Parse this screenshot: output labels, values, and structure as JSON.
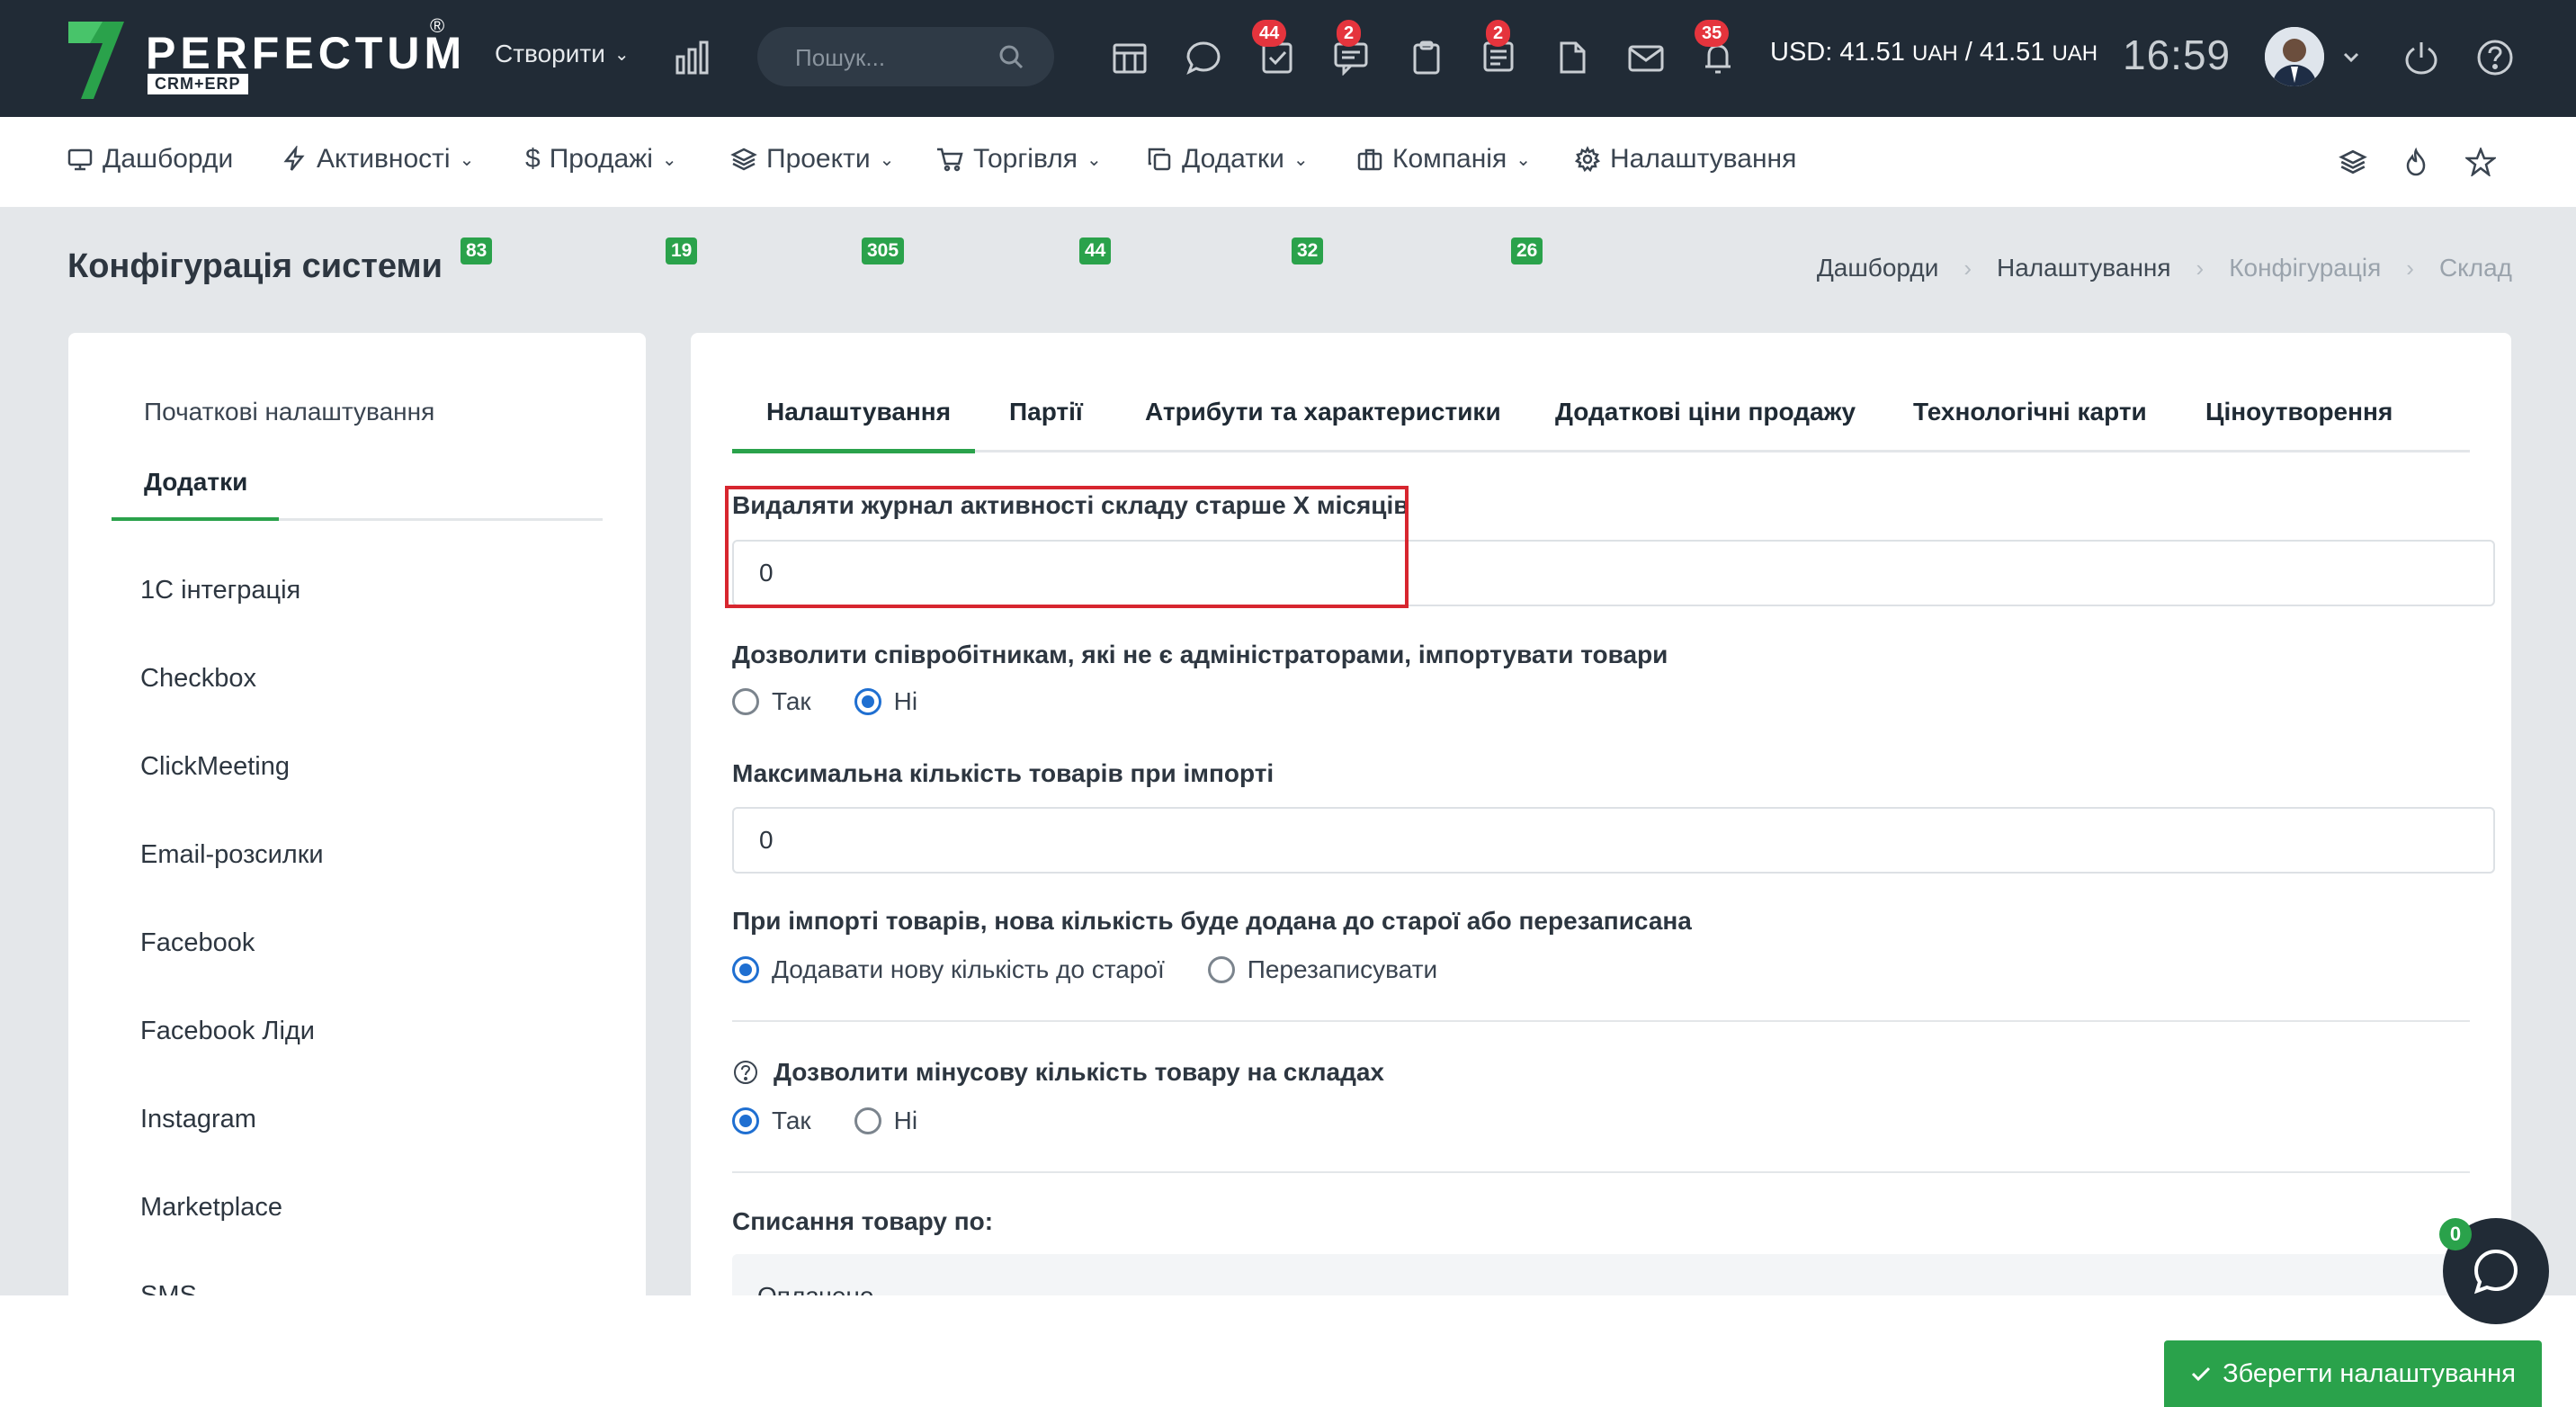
{
  "topbar": {
    "logo_text": "PERFECTUM",
    "logo_sub": "CRM+ERP",
    "logo_reg": "®",
    "create_label": "Створити",
    "search_placeholder": "Пошук...",
    "badges": {
      "tasks": "44",
      "chat": "2",
      "notes": "2",
      "notifications": "35"
    },
    "currency_prefix": "USD: 41.51",
    "currency_unit1": "UAH",
    "currency_mid": " / 41.51",
    "currency_unit2": "UAH",
    "clock": "16:59"
  },
  "nav": {
    "items": [
      {
        "label": "Дашборди",
        "badge": ""
      },
      {
        "label": "Активності",
        "badge": "83"
      },
      {
        "label": "Продажі",
        "badge": "19"
      },
      {
        "label": "Проекти",
        "badge": "305"
      },
      {
        "label": "Торгівля",
        "badge": "44"
      },
      {
        "label": "Додатки",
        "badge": "32"
      },
      {
        "label": "Компанія",
        "badge": "26"
      },
      {
        "label": "Налаштування",
        "badge": ""
      }
    ]
  },
  "page": {
    "title": "Конфігурація системи",
    "breadcrumbs": [
      "Дашборди",
      "Налаштування",
      "Конфігурація",
      "Склад"
    ]
  },
  "left_panel": {
    "tabs": [
      "Початкові налаштування",
      "Додатки"
    ],
    "items": [
      "1С інтеграція",
      "Checkbox",
      "ClickMeeting",
      "Email-розсилки",
      "Facebook",
      "Facebook Ліди",
      "Instagram",
      "Marketplace",
      "SMS"
    ]
  },
  "main_panel": {
    "tabs": [
      "Налаштування",
      "Партії",
      "Атрибути та характеристики",
      "Додаткові ціни продажу",
      "Технологічні карти",
      "Ціноутворення"
    ],
    "fields": {
      "log_months_label": "Видаляти журнал активності складу старше X місяців",
      "log_months_value": "0",
      "import_label": "Дозволити співробітникам, які не є адміністраторами, імпортувати товари",
      "import_yes": "Так",
      "import_no": "Ні",
      "max_import_label": "Максимальна кількість товарів при імпорті",
      "max_import_value": "0",
      "qty_mode_label": "При імпорті товарів, нова кількість буде додана до старої або перезаписана",
      "qty_mode_add": "Додавати нову кількість до старої",
      "qty_mode_overwrite": "Перезаписувати",
      "negative_label": "Дозволити мінусову кількість товару на складах",
      "negative_yes": "Так",
      "negative_no": "Ні",
      "writeoff_label": "Списання товару по:",
      "writeoff_value": "Оплачено"
    }
  },
  "footer": {
    "save_label": "Зберегти налаштування",
    "chat_badge": "0"
  },
  "colors": {
    "topbar": "#212b36",
    "accent_green": "#2aa24b",
    "badge_red": "#e5343d",
    "radio_blue": "#1f6fd1",
    "highlight_red": "#d7262f"
  }
}
